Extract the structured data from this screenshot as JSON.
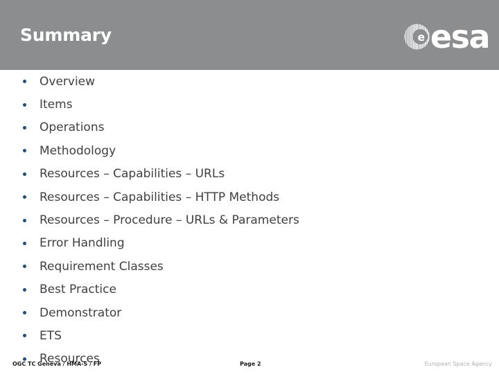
{
  "header": {
    "title": "Summary",
    "band_color": "#8b8d8f",
    "title_color": "#ffffff",
    "logo": {
      "emblem_name": "esa-globe-emblem",
      "wordmark": "esa"
    }
  },
  "content": {
    "bullet_color": "#1f4e79",
    "text_color": "#404040",
    "items": [
      {
        "label": "Overview"
      },
      {
        "label": "Items"
      },
      {
        "label": "Operations"
      },
      {
        "label": "Methodology"
      },
      {
        "label": "Resources – Capabilities – URLs"
      },
      {
        "label": "Resources – Capabilities – HTTP Methods"
      },
      {
        "label": "Resources – Procedure – URLs & Parameters"
      },
      {
        "label": "Error Handling"
      },
      {
        "label": "Requirement Classes"
      },
      {
        "label": "Best Practice"
      },
      {
        "label": "Demonstrator"
      },
      {
        "label": "ETS"
      },
      {
        "label": "Resources"
      }
    ]
  },
  "footer": {
    "left": "OGC TC Geneva / HMA-S / FP",
    "page": "Page 2",
    "right": "European Space Agency"
  }
}
